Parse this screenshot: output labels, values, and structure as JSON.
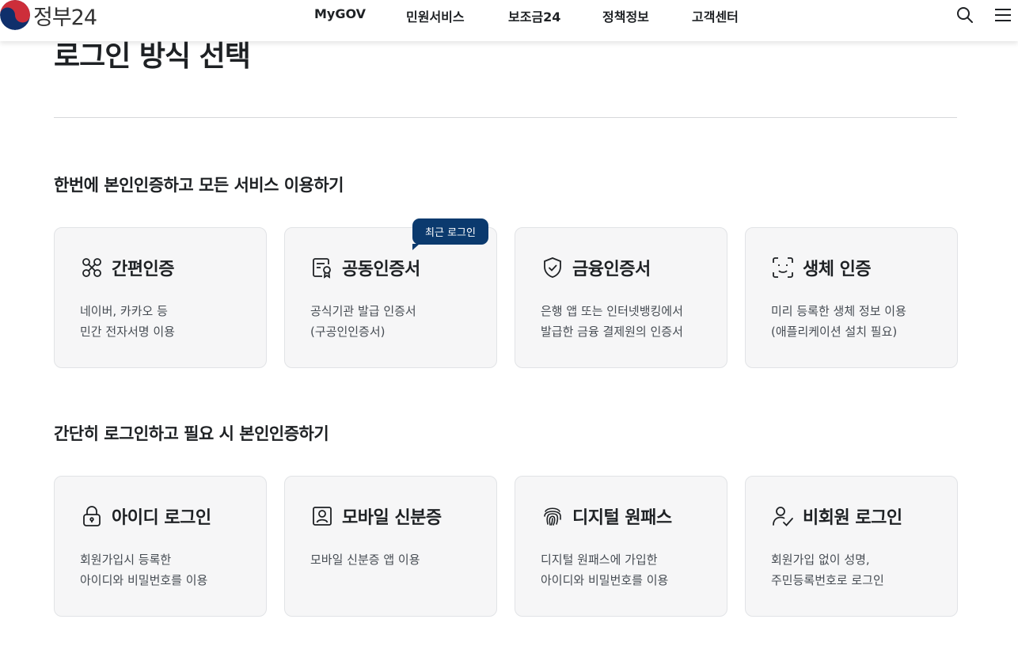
{
  "header": {
    "logo_text": "정부24",
    "nav": [
      "MyGOV",
      "민원서비스",
      "보조금24",
      "정책정보",
      "고객센터"
    ],
    "brand_colors": {
      "red": "#cd2e3a",
      "blue": "#0f2f6b"
    }
  },
  "page": {
    "title": "로그인 방식 선택"
  },
  "sections": [
    {
      "title": "한번에 본인인증하고 모든 서비스 이용하기",
      "cards": [
        {
          "title": "간편인증",
          "icon": "link-nodes-icon",
          "desc": [
            "네이버, 카카오 등",
            "민간 전자서명 이용"
          ]
        },
        {
          "title": "공동인증서",
          "icon": "certificate-icon",
          "desc": [
            "공식기관 발급 인증서",
            "(구공인인증서)"
          ],
          "badge": "최근 로그인"
        },
        {
          "title": "금융인증서",
          "icon": "shield-check-icon",
          "desc": [
            "은행 앱 또는 인터넷뱅킹에서",
            "발급한 금융 결제원의 인증서"
          ]
        },
        {
          "title": "생체 인증",
          "icon": "face-scan-icon",
          "desc": [
            "미리 등록한 생체 정보 이용",
            "(애플리케이션 설치 필요)"
          ]
        }
      ]
    },
    {
      "title": "간단히 로그인하고 필요 시 본인인증하기",
      "cards": [
        {
          "title": "아이디 로그인",
          "icon": "lock-icon",
          "desc": [
            "회원가입시 등록한",
            "아이디와 비밀번호를 이용"
          ]
        },
        {
          "title": "모바일 신분증",
          "icon": "id-card-icon",
          "desc": [
            "모바일 신분증 앱 이용"
          ]
        },
        {
          "title": "디지털 원패스",
          "icon": "fingerprint-icon",
          "desc": [
            "디지털 원패스에 가입한",
            "아이디와 비밀번호를 이용"
          ]
        },
        {
          "title": "비회원 로그인",
          "icon": "user-check-icon",
          "desc": [
            "회원가입 없이 성명,",
            "주민등록번호로 로그인"
          ]
        }
      ]
    }
  ]
}
